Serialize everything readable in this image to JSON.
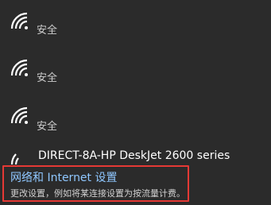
{
  "networks": [
    {
      "icon": "wifi-icon",
      "security": "安全"
    },
    {
      "icon": "wifi-icon",
      "security": "安全"
    },
    {
      "icon": "wifi-icon",
      "security": "安全"
    },
    {
      "icon": "wifi-icon",
      "ssid": "DIRECT-8A-HP DeskJet 2600 series"
    }
  ],
  "settings": {
    "title": "网络和 Internet 设置",
    "description": "更改设置，例如将某连接设置为按流量计费。"
  },
  "colors": {
    "background": "#2b2b2b",
    "link": "#8fc7ff",
    "highlight_border": "#e53935"
  }
}
